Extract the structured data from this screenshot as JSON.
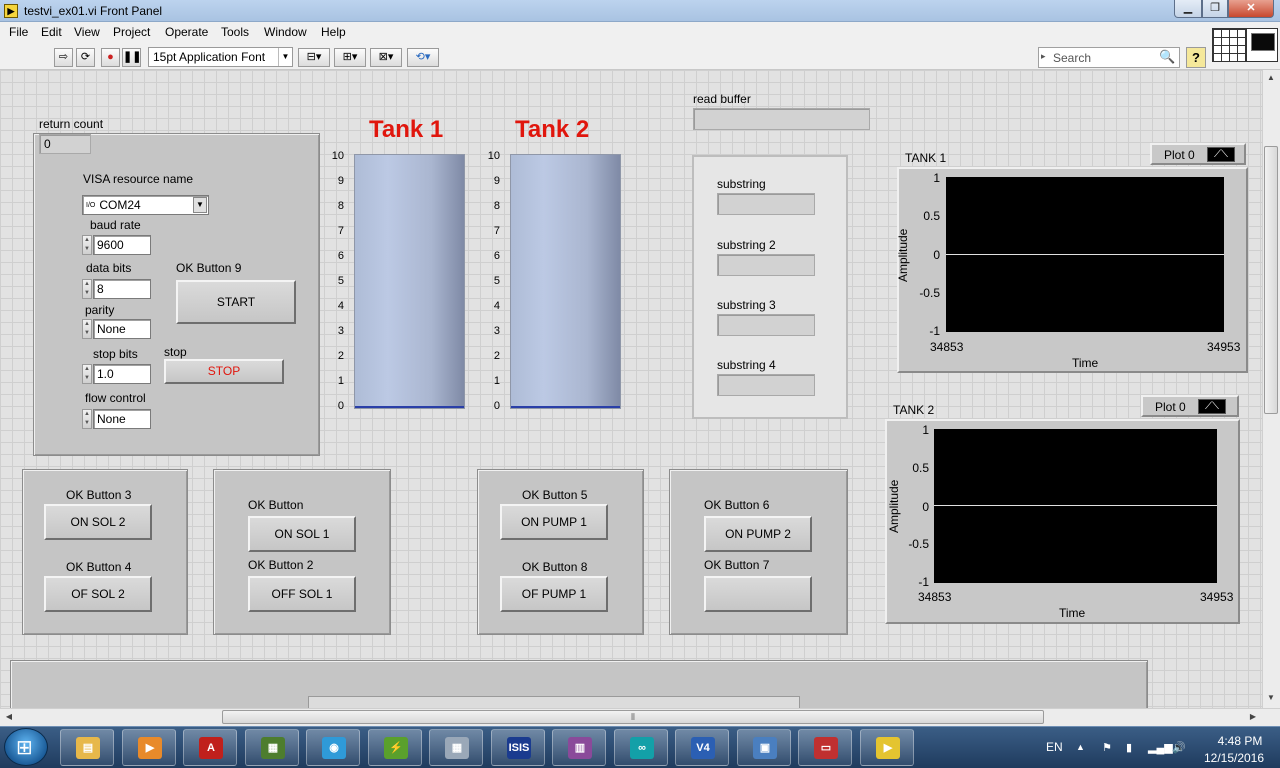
{
  "window": {
    "title": "testvi_ex01.vi Front Panel",
    "app_icon_text": "▶"
  },
  "menu": [
    "File",
    "Edit",
    "View",
    "Project",
    "Operate",
    "Tools",
    "Window",
    "Help"
  ],
  "toolbar": {
    "font": "15pt Application Font",
    "search_placeholder": "Search",
    "help": "?"
  },
  "controls": {
    "return_count": {
      "label": "return count",
      "value": "0"
    },
    "visa": {
      "label": "VISA resource name",
      "prefix": "I/O",
      "value": "COM24"
    },
    "baud_rate": {
      "label": "baud rate",
      "value": "9600"
    },
    "data_bits": {
      "label": "data bits",
      "value": "8"
    },
    "parity": {
      "label": "parity",
      "value": "None"
    },
    "stop_bits": {
      "label": "stop bits",
      "value": "1.0"
    },
    "flow_control": {
      "label": "flow control",
      "value": "None"
    },
    "ok9": {
      "label": "OK Button 9",
      "text": "START"
    },
    "stop": {
      "label": "stop",
      "text": "STOP"
    }
  },
  "tanks": [
    {
      "title": "Tank 1",
      "level": 0,
      "scale": [
        "10",
        "9",
        "8",
        "7",
        "6",
        "5",
        "4",
        "3",
        "2",
        "1",
        "0"
      ]
    },
    {
      "title": "Tank 2",
      "level": 0,
      "scale": [
        "10",
        "9",
        "8",
        "7",
        "6",
        "5",
        "4",
        "3",
        "2",
        "1",
        "0"
      ]
    }
  ],
  "buffers": {
    "read_buffer": "read buffer",
    "substrings": [
      "substring",
      "substring 2",
      "substring 3",
      "substring 4"
    ]
  },
  "graphs": [
    {
      "title": "TANK 1",
      "legend": "Plot 0",
      "ylabel": "Amplitude",
      "xlabel": "Time",
      "yticks": [
        "1",
        "0.5",
        "0",
        "-0.5",
        "-1"
      ],
      "xmin": "34853",
      "xmax": "34953"
    },
    {
      "title": "TANK 2",
      "legend": "Plot 0",
      "ylabel": "Amplitude",
      "xlabel": "Time",
      "yticks": [
        "1",
        "0.5",
        "0",
        "-0.5",
        "-1"
      ],
      "xmin": "34853",
      "xmax": "34953"
    }
  ],
  "button_groups": {
    "g1": {
      "a_label": "OK Button 3",
      "a_text": "ON SOL 2",
      "b_label": "OK Button 4",
      "b_text": "OF SOL 2"
    },
    "g2": {
      "a_label": "OK Button",
      "a_text": "ON SOL 1",
      "b_label": "OK Button 2",
      "b_text": "OFF SOL 1"
    },
    "g3": {
      "a_label": "OK Button 5",
      "a_text": "ON PUMP 1",
      "b_label": "OK Button 8",
      "b_text": "OF PUMP 1"
    },
    "g4": {
      "a_label": "OK Button 6",
      "a_text": "ON PUMP 2",
      "b_label": "OK Button 7",
      "b_text": ""
    }
  },
  "taskbar": {
    "apps": [
      "file-explorer",
      "media-player",
      "pdf-reader",
      "device-manager",
      "chrome",
      "arduino-ide-alt",
      "calculator",
      "isis",
      "winrar",
      "arduino",
      "v4",
      "control-panel",
      "toolbox",
      "labview"
    ],
    "app_colors": [
      "#e7b84a",
      "#e88a2a",
      "#c0201c",
      "#4d7d2e",
      "#2f9ad8",
      "#5aa02c",
      "#9aa8b8",
      "#1a3b8f",
      "#8a4a9a",
      "#13a0a8",
      "#2b5fb3",
      "#4a7fc0",
      "#c03030",
      "#e4c430"
    ],
    "app_glyphs": [
      "▤",
      "▶",
      "A",
      "▦",
      "◉",
      "⚡",
      "▦",
      "ISIS",
      "▥",
      "∞",
      "V4",
      "▣",
      "▭",
      "▶"
    ],
    "lang": "EN",
    "time": "4:48 PM",
    "date": "12/15/2016"
  },
  "colors": {
    "tank_title": "#e0160d",
    "stop_text": "#e0160d",
    "plot_bg": "#000000"
  }
}
